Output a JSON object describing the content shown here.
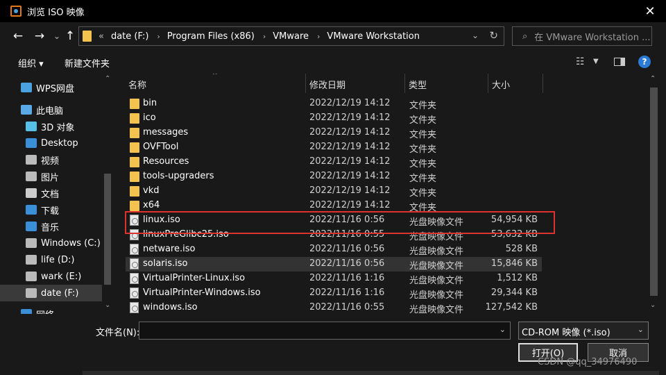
{
  "window": {
    "title": "浏览 ISO 映像",
    "close_glyph": "✕"
  },
  "nav": {
    "back_glyph": "←",
    "forward_glyph": "→",
    "recent_glyph": "⌄",
    "up_glyph": "↑",
    "overflow": "«",
    "breadcrumbs": [
      "date (F:)",
      "Program Files (x86)",
      "VMware",
      "VMware Workstation"
    ],
    "sep_glyph": "›",
    "dropdown_glyph": "⌄",
    "refresh_glyph": "↻",
    "search_placeholder": "在 VMware Workstation ...",
    "search_glyph": "⌕"
  },
  "toolbar": {
    "organize": "组织 ▾",
    "new_folder": "新建文件夹",
    "view_glyph": "☷",
    "view_drop_glyph": "▼",
    "help_glyph": "?"
  },
  "sidebar": {
    "items": [
      {
        "label": "WPS网盘",
        "icon": "cloud-icon",
        "color": "#4aa3df"
      },
      {
        "label": "此电脑",
        "icon": "computer-icon",
        "color": "#5aa9e6"
      },
      {
        "label": "3D 对象",
        "icon": "cube-icon",
        "color": "#55c1e8"
      },
      {
        "label": "Desktop",
        "icon": "desktop-icon",
        "color": "#3a8fd8"
      },
      {
        "label": "视频",
        "icon": "video-icon",
        "color": "#bbbbbb"
      },
      {
        "label": "图片",
        "icon": "picture-icon",
        "color": "#bbbbbb"
      },
      {
        "label": "文档",
        "icon": "document-icon",
        "color": "#cccccc"
      },
      {
        "label": "下载",
        "icon": "download-icon",
        "color": "#3a8fd8"
      },
      {
        "label": "音乐",
        "icon": "music-icon",
        "color": "#3a8fd8"
      },
      {
        "label": "Windows (C:)",
        "icon": "drive-icon",
        "color": "#bbbbbb"
      },
      {
        "label": "life (D:)",
        "icon": "drive-icon",
        "color": "#bbbbbb"
      },
      {
        "label": "wark (E:)",
        "icon": "drive-icon",
        "color": "#bbbbbb"
      },
      {
        "label": "date (F:)",
        "icon": "drive-icon",
        "color": "#bbbbbb",
        "selected": true
      },
      {
        "label": "网络",
        "icon": "network-icon",
        "color": "#3a8fd8"
      }
    ],
    "up_glyph": "⌃",
    "down_glyph": "⌄"
  },
  "columns": {
    "name": "名称",
    "modified": "修改日期",
    "type": "类型",
    "size": "大小",
    "sort_glyph": "^"
  },
  "files": [
    {
      "name": "bin",
      "date": "2022/12/19 14:12",
      "type": "文件夹",
      "size": "",
      "kind": "folder"
    },
    {
      "name": "ico",
      "date": "2022/12/19 14:12",
      "type": "文件夹",
      "size": "",
      "kind": "folder"
    },
    {
      "name": "messages",
      "date": "2022/12/19 14:12",
      "type": "文件夹",
      "size": "",
      "kind": "folder"
    },
    {
      "name": "OVFTool",
      "date": "2022/12/19 14:12",
      "type": "文件夹",
      "size": "",
      "kind": "folder"
    },
    {
      "name": "Resources",
      "date": "2022/12/19 14:12",
      "type": "文件夹",
      "size": "",
      "kind": "folder"
    },
    {
      "name": "tools-upgraders",
      "date": "2022/12/19 14:12",
      "type": "文件夹",
      "size": "",
      "kind": "folder"
    },
    {
      "name": "vkd",
      "date": "2022/12/19 14:12",
      "type": "文件夹",
      "size": "",
      "kind": "folder"
    },
    {
      "name": "x64",
      "date": "2022/12/19 14:12",
      "type": "文件夹",
      "size": "",
      "kind": "folder"
    },
    {
      "name": "linux.iso",
      "date": "2022/11/16 0:56",
      "type": "光盘映像文件",
      "size": "54,954 KB",
      "kind": "iso"
    },
    {
      "name": "linuxPreGlibc25.iso",
      "date": "2022/11/16 0:55",
      "type": "光盘映像文件",
      "size": "53,632 KB",
      "kind": "iso"
    },
    {
      "name": "netware.iso",
      "date": "2022/11/16 0:56",
      "type": "光盘映像文件",
      "size": "528 KB",
      "kind": "iso"
    },
    {
      "name": "solaris.iso",
      "date": "2022/11/16 0:56",
      "type": "光盘映像文件",
      "size": "15,846 KB",
      "kind": "iso",
      "hover": true
    },
    {
      "name": "VirtualPrinter-Linux.iso",
      "date": "2022/11/16 1:16",
      "type": "光盘映像文件",
      "size": "1,512 KB",
      "kind": "iso"
    },
    {
      "name": "VirtualPrinter-Windows.iso",
      "date": "2022/11/16 1:16",
      "type": "光盘映像文件",
      "size": "29,344 KB",
      "kind": "iso"
    },
    {
      "name": "windows.iso",
      "date": "2022/11/16 0:55",
      "type": "光盘映像文件",
      "size": "127,542 KB",
      "kind": "iso"
    }
  ],
  "footer": {
    "filename_label": "文件名(N):",
    "filename_value": "",
    "filter_value": "CD-ROM 映像 (*.iso)",
    "drop_glyph": "⌄",
    "open_label": "打开(O)",
    "cancel_label": "取消",
    "watermark": "CSDN @qq_34976490"
  },
  "colors": {
    "highlight": "#e03131",
    "folder": "#f3c24f",
    "accent": "#2b7bd4"
  }
}
